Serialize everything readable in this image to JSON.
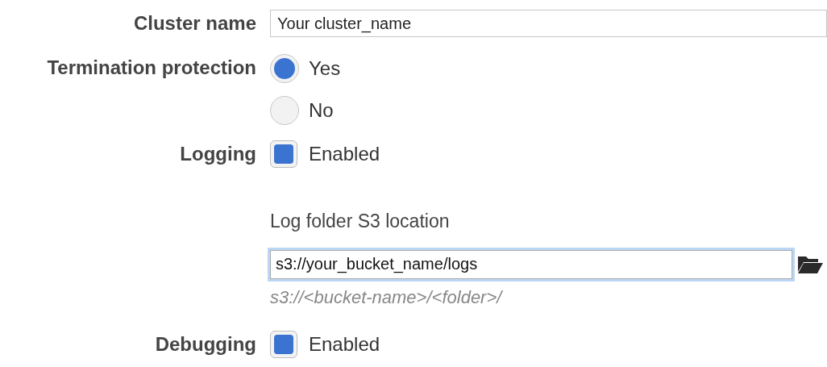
{
  "cluster_name": {
    "label": "Cluster name",
    "value": "Your cluster_name"
  },
  "termination_protection": {
    "label": "Termination protection",
    "options": [
      {
        "label": "Yes",
        "selected": true
      },
      {
        "label": "No",
        "selected": false
      }
    ]
  },
  "logging": {
    "label": "Logging",
    "checkbox": {
      "label": "Enabled",
      "checked": true
    },
    "log_folder": {
      "label": "Log folder S3 location",
      "value": "s3://your_bucket_name/logs",
      "hint": "s3://<bucket-name>/<folder>/"
    }
  },
  "debugging": {
    "label": "Debugging",
    "checkbox": {
      "label": "Enabled",
      "checked": true
    }
  }
}
